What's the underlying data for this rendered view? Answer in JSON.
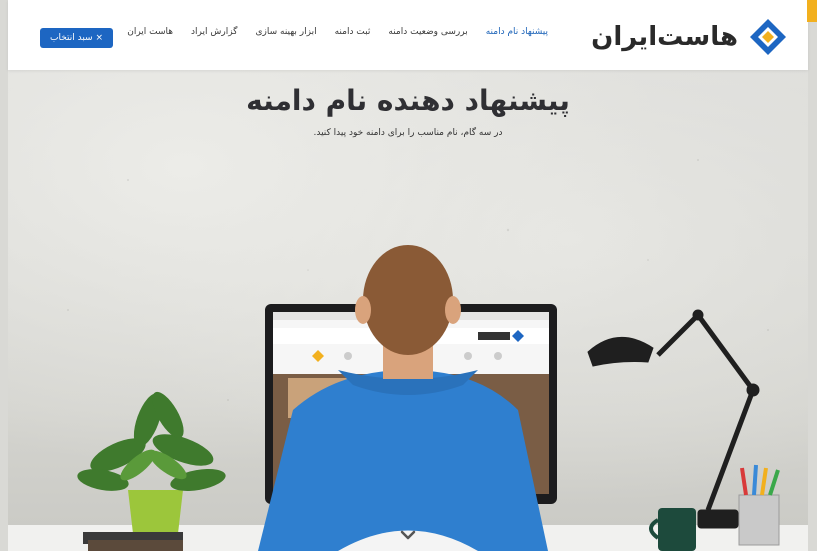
{
  "navbar": {
    "logo_text": "هاست‌ایران",
    "links": [
      {
        "label": "پیشنهاد نام دامنه",
        "active": true
      },
      {
        "label": "بررسی وضعیت دامنه",
        "active": false
      },
      {
        "label": "ثبت دامنه",
        "active": false
      },
      {
        "label": "ابزار بهینه سازی",
        "active": false
      },
      {
        "label": "گزارش ایراد",
        "active": false
      },
      {
        "label": "هاست ایران",
        "active": false
      }
    ],
    "cart_label": "سبد انتخاب ×"
  },
  "hero": {
    "title": "پیشنهاد دهنده نام دامنه",
    "subtitle": "در سه گام، نام مناسب را برای دامنه خود پیدا کنید."
  },
  "colors": {
    "brand_blue": "#1d66c2",
    "accent_orange": "#f2b01e",
    "shirt_blue": "#2f7fcf"
  },
  "icons": {
    "logo": "diamond-logo-icon",
    "scroll": "chevron-down-icon"
  }
}
